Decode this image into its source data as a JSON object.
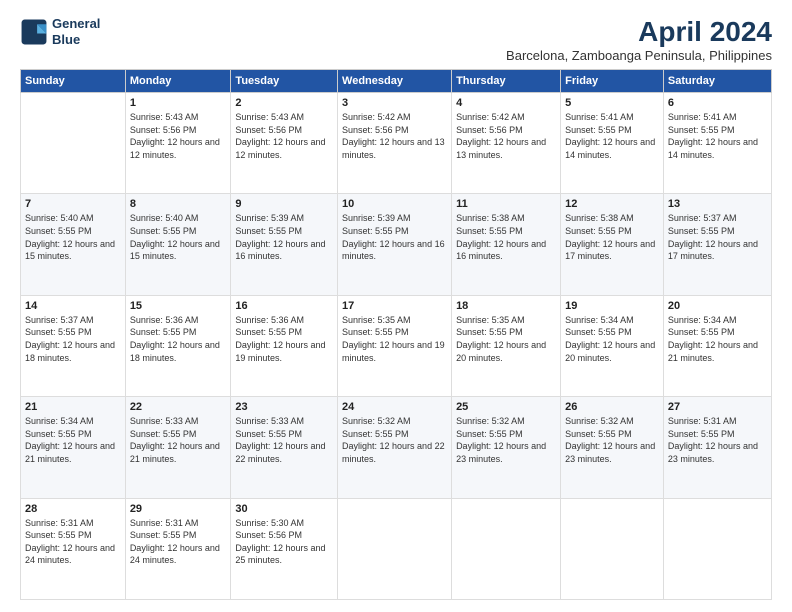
{
  "logo": {
    "line1": "General",
    "line2": "Blue"
  },
  "title": "April 2024",
  "subtitle": "Barcelona, Zamboanga Peninsula, Philippines",
  "days_header": [
    "Sunday",
    "Monday",
    "Tuesday",
    "Wednesday",
    "Thursday",
    "Friday",
    "Saturday"
  ],
  "weeks": [
    [
      {
        "num": "",
        "sunrise": "",
        "sunset": "",
        "daylight": ""
      },
      {
        "num": "1",
        "sunrise": "Sunrise: 5:43 AM",
        "sunset": "Sunset: 5:56 PM",
        "daylight": "Daylight: 12 hours and 12 minutes."
      },
      {
        "num": "2",
        "sunrise": "Sunrise: 5:43 AM",
        "sunset": "Sunset: 5:56 PM",
        "daylight": "Daylight: 12 hours and 12 minutes."
      },
      {
        "num": "3",
        "sunrise": "Sunrise: 5:42 AM",
        "sunset": "Sunset: 5:56 PM",
        "daylight": "Daylight: 12 hours and 13 minutes."
      },
      {
        "num": "4",
        "sunrise": "Sunrise: 5:42 AM",
        "sunset": "Sunset: 5:56 PM",
        "daylight": "Daylight: 12 hours and 13 minutes."
      },
      {
        "num": "5",
        "sunrise": "Sunrise: 5:41 AM",
        "sunset": "Sunset: 5:55 PM",
        "daylight": "Daylight: 12 hours and 14 minutes."
      },
      {
        "num": "6",
        "sunrise": "Sunrise: 5:41 AM",
        "sunset": "Sunset: 5:55 PM",
        "daylight": "Daylight: 12 hours and 14 minutes."
      }
    ],
    [
      {
        "num": "7",
        "sunrise": "Sunrise: 5:40 AM",
        "sunset": "Sunset: 5:55 PM",
        "daylight": "Daylight: 12 hours and 15 minutes."
      },
      {
        "num": "8",
        "sunrise": "Sunrise: 5:40 AM",
        "sunset": "Sunset: 5:55 PM",
        "daylight": "Daylight: 12 hours and 15 minutes."
      },
      {
        "num": "9",
        "sunrise": "Sunrise: 5:39 AM",
        "sunset": "Sunset: 5:55 PM",
        "daylight": "Daylight: 12 hours and 16 minutes."
      },
      {
        "num": "10",
        "sunrise": "Sunrise: 5:39 AM",
        "sunset": "Sunset: 5:55 PM",
        "daylight": "Daylight: 12 hours and 16 minutes."
      },
      {
        "num": "11",
        "sunrise": "Sunrise: 5:38 AM",
        "sunset": "Sunset: 5:55 PM",
        "daylight": "Daylight: 12 hours and 16 minutes."
      },
      {
        "num": "12",
        "sunrise": "Sunrise: 5:38 AM",
        "sunset": "Sunset: 5:55 PM",
        "daylight": "Daylight: 12 hours and 17 minutes."
      },
      {
        "num": "13",
        "sunrise": "Sunrise: 5:37 AM",
        "sunset": "Sunset: 5:55 PM",
        "daylight": "Daylight: 12 hours and 17 minutes."
      }
    ],
    [
      {
        "num": "14",
        "sunrise": "Sunrise: 5:37 AM",
        "sunset": "Sunset: 5:55 PM",
        "daylight": "Daylight: 12 hours and 18 minutes."
      },
      {
        "num": "15",
        "sunrise": "Sunrise: 5:36 AM",
        "sunset": "Sunset: 5:55 PM",
        "daylight": "Daylight: 12 hours and 18 minutes."
      },
      {
        "num": "16",
        "sunrise": "Sunrise: 5:36 AM",
        "sunset": "Sunset: 5:55 PM",
        "daylight": "Daylight: 12 hours and 19 minutes."
      },
      {
        "num": "17",
        "sunrise": "Sunrise: 5:35 AM",
        "sunset": "Sunset: 5:55 PM",
        "daylight": "Daylight: 12 hours and 19 minutes."
      },
      {
        "num": "18",
        "sunrise": "Sunrise: 5:35 AM",
        "sunset": "Sunset: 5:55 PM",
        "daylight": "Daylight: 12 hours and 20 minutes."
      },
      {
        "num": "19",
        "sunrise": "Sunrise: 5:34 AM",
        "sunset": "Sunset: 5:55 PM",
        "daylight": "Daylight: 12 hours and 20 minutes."
      },
      {
        "num": "20",
        "sunrise": "Sunrise: 5:34 AM",
        "sunset": "Sunset: 5:55 PM",
        "daylight": "Daylight: 12 hours and 21 minutes."
      }
    ],
    [
      {
        "num": "21",
        "sunrise": "Sunrise: 5:34 AM",
        "sunset": "Sunset: 5:55 PM",
        "daylight": "Daylight: 12 hours and 21 minutes."
      },
      {
        "num": "22",
        "sunrise": "Sunrise: 5:33 AM",
        "sunset": "Sunset: 5:55 PM",
        "daylight": "Daylight: 12 hours and 21 minutes."
      },
      {
        "num": "23",
        "sunrise": "Sunrise: 5:33 AM",
        "sunset": "Sunset: 5:55 PM",
        "daylight": "Daylight: 12 hours and 22 minutes."
      },
      {
        "num": "24",
        "sunrise": "Sunrise: 5:32 AM",
        "sunset": "Sunset: 5:55 PM",
        "daylight": "Daylight: 12 hours and 22 minutes."
      },
      {
        "num": "25",
        "sunrise": "Sunrise: 5:32 AM",
        "sunset": "Sunset: 5:55 PM",
        "daylight": "Daylight: 12 hours and 23 minutes."
      },
      {
        "num": "26",
        "sunrise": "Sunrise: 5:32 AM",
        "sunset": "Sunset: 5:55 PM",
        "daylight": "Daylight: 12 hours and 23 minutes."
      },
      {
        "num": "27",
        "sunrise": "Sunrise: 5:31 AM",
        "sunset": "Sunset: 5:55 PM",
        "daylight": "Daylight: 12 hours and 23 minutes."
      }
    ],
    [
      {
        "num": "28",
        "sunrise": "Sunrise: 5:31 AM",
        "sunset": "Sunset: 5:55 PM",
        "daylight": "Daylight: 12 hours and 24 minutes."
      },
      {
        "num": "29",
        "sunrise": "Sunrise: 5:31 AM",
        "sunset": "Sunset: 5:55 PM",
        "daylight": "Daylight: 12 hours and 24 minutes."
      },
      {
        "num": "30",
        "sunrise": "Sunrise: 5:30 AM",
        "sunset": "Sunset: 5:56 PM",
        "daylight": "Daylight: 12 hours and 25 minutes."
      },
      {
        "num": "",
        "sunrise": "",
        "sunset": "",
        "daylight": ""
      },
      {
        "num": "",
        "sunrise": "",
        "sunset": "",
        "daylight": ""
      },
      {
        "num": "",
        "sunrise": "",
        "sunset": "",
        "daylight": ""
      },
      {
        "num": "",
        "sunrise": "",
        "sunset": "",
        "daylight": ""
      }
    ]
  ]
}
